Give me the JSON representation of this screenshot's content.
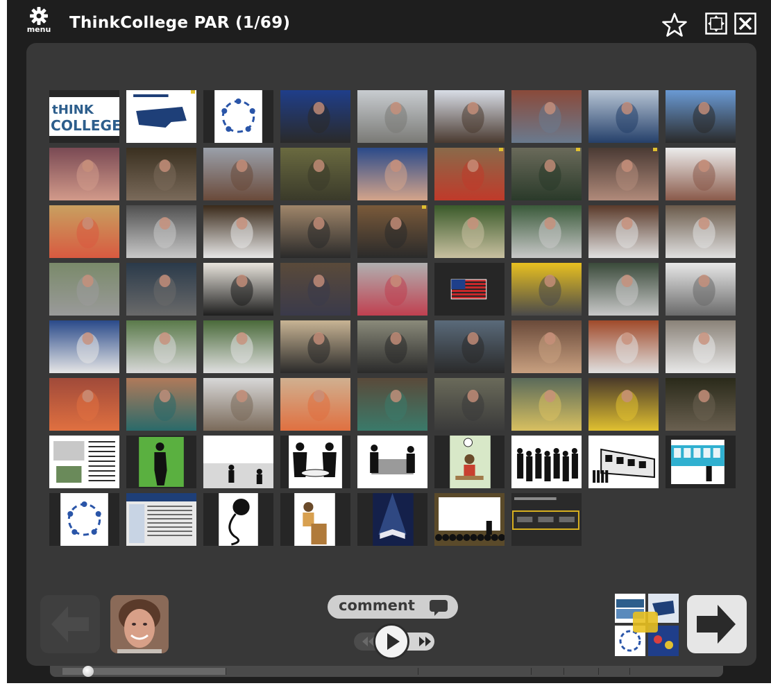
{
  "window": {
    "title": "ThinkCollege PAR (1/69)",
    "menu_label": "menu",
    "icons": {
      "menu": "gear-icon",
      "favorite": "star-icon",
      "fullscreen": "fullscreen-icon",
      "close": "close-icon"
    }
  },
  "slides": [
    {
      "kind": "think-college-logo",
      "text": [
        "tHINK",
        "COLLEGE!"
      ],
      "colors": [
        "#ffffff",
        "#2d5e8c"
      ]
    },
    {
      "kind": "map",
      "colors": [
        "#ffffff",
        "#1e3f78"
      ],
      "marked": true
    },
    {
      "kind": "cycle-diagram",
      "colors": [
        "#ffffff",
        "#2a55a8"
      ]
    },
    {
      "kind": "photo",
      "colors": [
        "#1f3e8a",
        "#2a2a2a"
      ]
    },
    {
      "kind": "photo",
      "colors": [
        "#c8ccd0",
        "#7a7a76"
      ]
    },
    {
      "kind": "photo",
      "colors": [
        "#d8dde6",
        "#4a3a30"
      ]
    },
    {
      "kind": "photo",
      "colors": [
        "#8a4a3a",
        "#6a7a8e"
      ]
    },
    {
      "kind": "photo",
      "colors": [
        "#b6c4d4",
        "#25406a"
      ]
    },
    {
      "kind": "photo",
      "colors": [
        "#6a9ad4",
        "#2a2a2a"
      ]
    },
    {
      "kind": "photo",
      "colors": [
        "#7a4a54",
        "#d29a8a"
      ]
    },
    {
      "kind": "photo",
      "colors": [
        "#3a3020",
        "#7a6a5a"
      ]
    },
    {
      "kind": "photo",
      "colors": [
        "#9aa0aa",
        "#6a4a3a"
      ]
    },
    {
      "kind": "photo",
      "colors": [
        "#6a6a40",
        "#3a3a2a"
      ]
    },
    {
      "kind": "photo",
      "colors": [
        "#2a4a8a",
        "#d4a48a"
      ]
    },
    {
      "kind": "photo",
      "colors": [
        "#8a6a4a",
        "#c03a2a"
      ],
      "marked": true
    },
    {
      "kind": "photo",
      "colors": [
        "#6a6a5a",
        "#2a3a2a"
      ],
      "marked": true
    },
    {
      "kind": "photo",
      "colors": [
        "#4a3a34",
        "#b08a7a"
      ],
      "marked": true
    },
    {
      "kind": "photo",
      "colors": [
        "#ececec",
        "#8a5a4a"
      ]
    },
    {
      "kind": "photo",
      "colors": [
        "#c8a060",
        "#d85a40"
      ]
    },
    {
      "kind": "photo",
      "colors": [
        "#505050",
        "#c8c8c8"
      ]
    },
    {
      "kind": "photo",
      "colors": [
        "#3a2a1a",
        "#e6e6e6"
      ]
    },
    {
      "kind": "photo",
      "colors": [
        "#a0866a",
        "#2a2a2a"
      ]
    },
    {
      "kind": "photo",
      "colors": [
        "#7a5a3a",
        "#2a2a2a"
      ],
      "marked": true
    },
    {
      "kind": "photo",
      "colors": [
        "#3a5a2a",
        "#c8c0a0"
      ]
    },
    {
      "kind": "photo",
      "colors": [
        "#3a5a3a",
        "#c8c8c8"
      ]
    },
    {
      "kind": "photo",
      "colors": [
        "#5a3a2a",
        "#e0e0e0"
      ]
    },
    {
      "kind": "photo",
      "colors": [
        "#6a5a4a",
        "#e0e0e0"
      ]
    },
    {
      "kind": "photo",
      "colors": [
        "#7a8a6a",
        "#9a9a9a"
      ]
    },
    {
      "kind": "photo",
      "colors": [
        "#2a3a4a",
        "#6a6a6a"
      ]
    },
    {
      "kind": "photo",
      "colors": [
        "#e8e4dc",
        "#1e1e1e"
      ]
    },
    {
      "kind": "photo",
      "colors": [
        "#5a4a3a",
        "#3a3a4a"
      ]
    },
    {
      "kind": "photo",
      "colors": [
        "#b0b0b0",
        "#c04050"
      ]
    },
    {
      "kind": "flag",
      "colors": [
        "#c8282a",
        "#1e3f8a"
      ]
    },
    {
      "kind": "photo",
      "colors": [
        "#e8c020",
        "#4a4a4a"
      ]
    },
    {
      "kind": "photo",
      "colors": [
        "#3a4a3a",
        "#c8c8c8"
      ]
    },
    {
      "kind": "photo",
      "colors": [
        "#e8e8e8",
        "#6a6a6a"
      ]
    },
    {
      "kind": "photo",
      "colors": [
        "#2a4a8a",
        "#e6e6e6"
      ]
    },
    {
      "kind": "photo",
      "colors": [
        "#5a7a4a",
        "#d8d8d8"
      ]
    },
    {
      "kind": "photo",
      "colors": [
        "#4a6a3a",
        "#e0e0e0"
      ]
    },
    {
      "kind": "photo",
      "colors": [
        "#c8b494",
        "#2a2a2a"
      ]
    },
    {
      "kind": "photo",
      "colors": [
        "#8a8a7a",
        "#2a2a2a"
      ]
    },
    {
      "kind": "photo",
      "colors": [
        "#5a6a7a",
        "#2a2a2a"
      ]
    },
    {
      "kind": "photo",
      "colors": [
        "#6a4a3a",
        "#c8a080"
      ]
    },
    {
      "kind": "photo",
      "colors": [
        "#a04a2a",
        "#e0e0e0"
      ]
    },
    {
      "kind": "photo",
      "colors": [
        "#8a8278",
        "#e8e8e8"
      ]
    },
    {
      "kind": "photo",
      "colors": [
        "#a04a3a",
        "#e07040"
      ]
    },
    {
      "kind": "photo",
      "colors": [
        "#b07a5a",
        "#2a6a6a"
      ]
    },
    {
      "kind": "photo",
      "colors": [
        "#d8d8d8",
        "#7a6a5a"
      ]
    },
    {
      "kind": "photo",
      "colors": [
        "#d0b090",
        "#e07040"
      ]
    },
    {
      "kind": "photo",
      "colors": [
        "#5a4a3a",
        "#3a7a6a"
      ]
    },
    {
      "kind": "photo",
      "colors": [
        "#6a6a5a",
        "#3a3a3a"
      ]
    },
    {
      "kind": "photo",
      "colors": [
        "#5a6a5a",
        "#d8c060"
      ]
    },
    {
      "kind": "photo",
      "colors": [
        "#4a3a2a",
        "#e0c030"
      ]
    },
    {
      "kind": "photo",
      "colors": [
        "#2a2a1a",
        "#6a6050"
      ]
    },
    {
      "kind": "document",
      "colors": [
        "#ffffff",
        "#2a2a2a"
      ]
    },
    {
      "kind": "silhouette-person",
      "colors": [
        "#5ab040",
        "#111111"
      ]
    },
    {
      "kind": "silhouette-group",
      "colors": [
        "#ffffff",
        "#111111"
      ]
    },
    {
      "kind": "silhouette-table",
      "colors": [
        "#ffffff",
        "#111111"
      ]
    },
    {
      "kind": "silhouette-desk",
      "colors": [
        "#ffffff",
        "#111111"
      ]
    },
    {
      "kind": "illustration-desk",
      "colors": [
        "#d8e8c8",
        "#c84030"
      ]
    },
    {
      "kind": "silhouette-crowd",
      "colors": [
        "#ffffff",
        "#111111"
      ]
    },
    {
      "kind": "bus",
      "colors": [
        "#ffffff",
        "#111111"
      ]
    },
    {
      "kind": "train",
      "colors": [
        "#30b0d0",
        "#111111"
      ]
    },
    {
      "kind": "cycle-diagram",
      "colors": [
        "#ffffff",
        "#2a55a8"
      ]
    },
    {
      "kind": "screenshot",
      "colors": [
        "#e8e8e8",
        "#1e3f78"
      ]
    },
    {
      "kind": "microphone",
      "colors": [
        "#ffffff",
        "#111111"
      ]
    },
    {
      "kind": "speaker-podium",
      "colors": [
        "#ffffff",
        "#b07a3a"
      ]
    },
    {
      "kind": "book-spotlight",
      "colors": [
        "#14204a",
        "#e8e8f0"
      ]
    },
    {
      "kind": "presentation",
      "colors": [
        "#ffffff",
        "#111111"
      ]
    },
    {
      "kind": "ui-screenshot",
      "colors": [
        "#2a2a2a",
        "#d8b020"
      ]
    }
  ],
  "controls": {
    "comment_label": "comment",
    "icons": {
      "prev": "arrow-left-icon",
      "next": "arrow-right-icon",
      "play": "play-icon",
      "rewind": "rewind-icon",
      "fast_forward": "fast-forward-icon",
      "comment": "speech-bubble-icon"
    },
    "presenter_avatar_colors": [
      "#6a4a3a",
      "#c89078"
    ]
  },
  "accent": {
    "frame_bg": "#1e1e1e",
    "panel_bg": "#383838",
    "marker": "#e0c030"
  }
}
